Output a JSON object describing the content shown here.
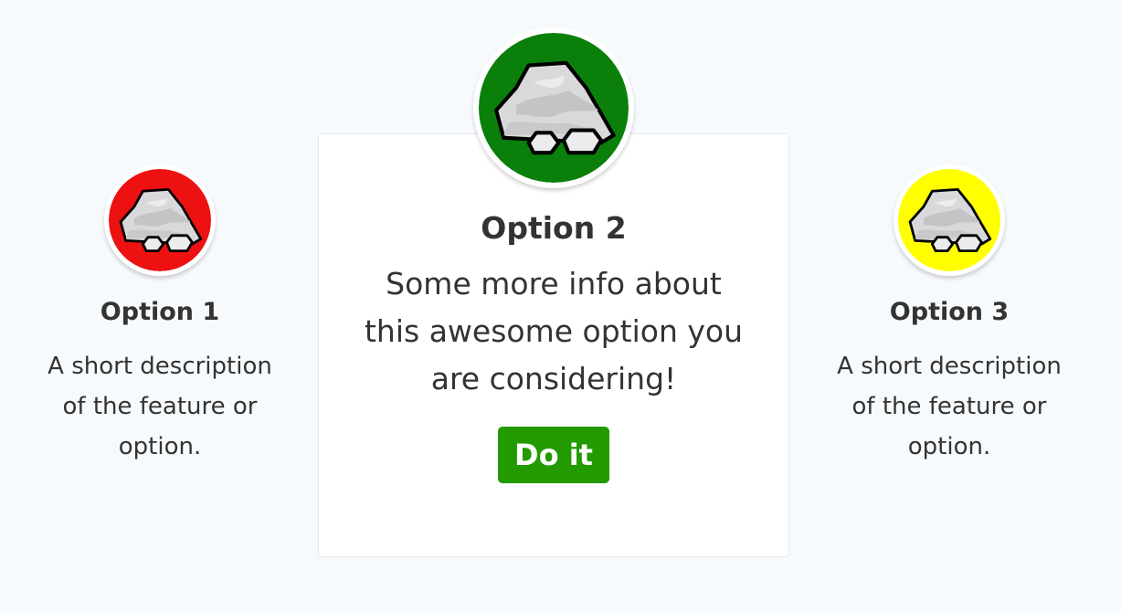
{
  "options": [
    {
      "title": "Option 1",
      "description": "A short description of the feature or option.",
      "ring_color": "#ee1111",
      "icon": "rock-icon"
    },
    {
      "title": "Option 2",
      "description": "Some more info about this awesome option you are considering!",
      "ring_color": "#0a7f0a",
      "icon": "rock-icon",
      "button_label": "Do it",
      "button_color": "#229a00"
    },
    {
      "title": "Option 3",
      "description": "A short description of the feature or option.",
      "ring_color": "#ffff00",
      "icon": "rock-icon"
    }
  ]
}
